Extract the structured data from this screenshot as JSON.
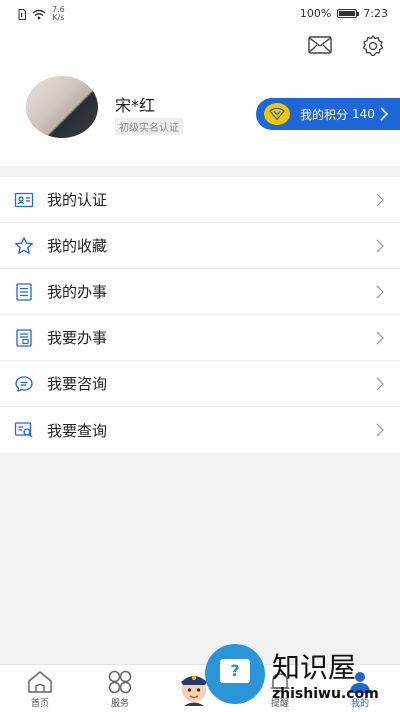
{
  "status_bar": {
    "net_speed_value": "7.6",
    "net_speed_unit": "K/s",
    "battery_percent": "100%",
    "time": "7:23"
  },
  "profile": {
    "name": "宋*红",
    "badge": "初级实名认证",
    "points_label": "我的积分",
    "points_value": "140"
  },
  "menu": {
    "items": [
      {
        "label": "我的认证",
        "icon": "id-card-icon"
      },
      {
        "label": "我的收藏",
        "icon": "star-icon"
      },
      {
        "label": "我的办事",
        "icon": "list-icon"
      },
      {
        "label": "我要办事",
        "icon": "form-icon"
      },
      {
        "label": "我要咨询",
        "icon": "chat-icon"
      },
      {
        "label": "我要查询",
        "icon": "search-doc-icon"
      }
    ]
  },
  "tabbar": {
    "home": "首页",
    "service": "服务",
    "remind": "提醒",
    "mine": "我的"
  },
  "watermark": {
    "title": "知识屋",
    "url": "zhishiwu.com"
  },
  "colors": {
    "accent": "#1f66d6",
    "coin": "#f5c400",
    "icon": "#1f66d6"
  }
}
